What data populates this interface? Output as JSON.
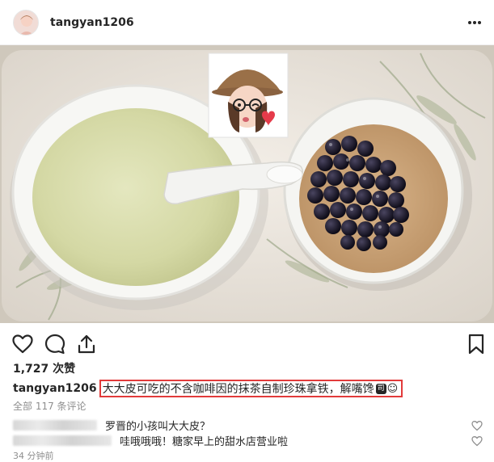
{
  "header": {
    "username": "tangyan1206",
    "avatar_icon": "user-avatar-icon",
    "more_icon": "more-horizontal-icon"
  },
  "photo": {
    "sticker_icon": "memoji-sticker-icon"
  },
  "actions": {
    "like_icon": "heart-icon",
    "comment_icon": "comment-icon",
    "share_icon": "share-icon",
    "save_icon": "bookmark-icon"
  },
  "likes": {
    "text": "1,727 次赞"
  },
  "caption": {
    "username": "tangyan1206",
    "text": "大大皮可吃的不含咖啡因的抹茶自制珍珠拿铁，解嘴馋",
    "badge": "司",
    "emoji": "☺",
    "highlight_color": "#e23b3b"
  },
  "view_all": {
    "text": "全部 117 条评论"
  },
  "comments": [
    {
      "text": "罗晋的小孩叫大大皮？"
    },
    {
      "text": "哇哦哦哦！糖家早上的甜水店营业啦"
    }
  ],
  "timestamp": {
    "text": "34 分钟前"
  }
}
